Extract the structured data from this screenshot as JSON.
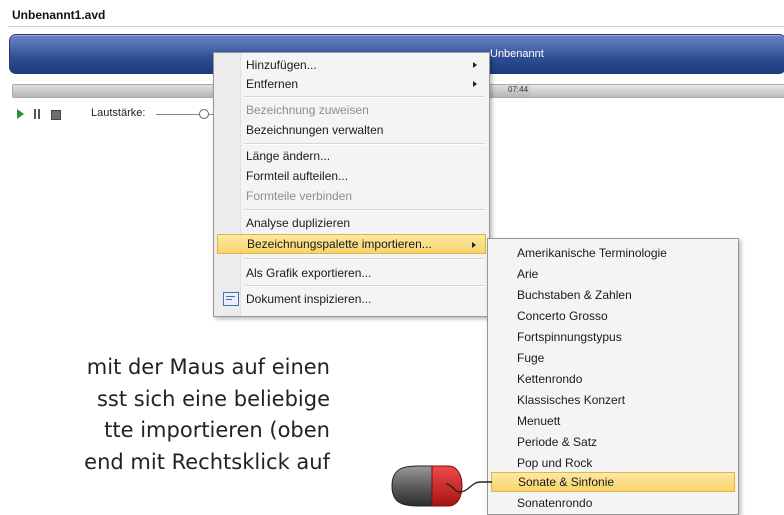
{
  "document": {
    "title": "Unbenannt1.avd"
  },
  "timeline": {
    "label": "Unbenannt",
    "time": "07:44",
    "progress": 0.67
  },
  "transport": {
    "play_icon": "play-icon",
    "pause_icon": "pause-icon",
    "stop_icon": "stop-icon",
    "volume_label": "Lautstärke:"
  },
  "context_menu": {
    "items": [
      {
        "label": "Hinzufügen...",
        "disabled": false,
        "submenu": true
      },
      {
        "label": "Entfernen",
        "disabled": false,
        "submenu": true
      },
      {
        "label": "Bezeichnung zuweisen",
        "disabled": true,
        "submenu": false
      },
      {
        "label": "Bezeichnungen verwalten",
        "disabled": false,
        "submenu": false
      },
      {
        "label": "Länge ändern...",
        "disabled": false,
        "submenu": false
      },
      {
        "label": "Formteil aufteilen...",
        "disabled": false,
        "submenu": false
      },
      {
        "label": "Formteile verbinden",
        "disabled": true,
        "submenu": false
      },
      {
        "label": "Analyse duplizieren",
        "disabled": false,
        "submenu": false
      },
      {
        "label": "Bezeichnungspalette importieren...",
        "disabled": false,
        "submenu": true,
        "highlighted": true
      },
      {
        "label": "Als Grafik exportieren...",
        "disabled": false,
        "submenu": false
      },
      {
        "label": "Dokument inspizieren...",
        "disabled": false,
        "submenu": false,
        "icon": "document-inspect-icon"
      }
    ]
  },
  "submenu": {
    "items": [
      "Amerikanische Terminologie",
      "Arie",
      "Buchstaben & Zahlen",
      "Concerto Grosso",
      "Fortspinnungstypus",
      "Fuge",
      "Kettenrondo",
      "Klassisches Konzert",
      "Menuett",
      "Periode & Satz",
      "Pop und Rock",
      "Sonate & Sinfonie",
      "Sonatenrondo"
    ],
    "highlighted_index": 11
  },
  "body_text": {
    "lines": [
      "mit der Maus auf einen",
      "sst sich eine beliebige",
      "tte importieren (oben",
      "end mit Rechtsklick auf"
    ]
  },
  "colors": {
    "timeline": "#2f4d93",
    "highlight": "#f7d36a",
    "mouse_button": "#d62828"
  }
}
